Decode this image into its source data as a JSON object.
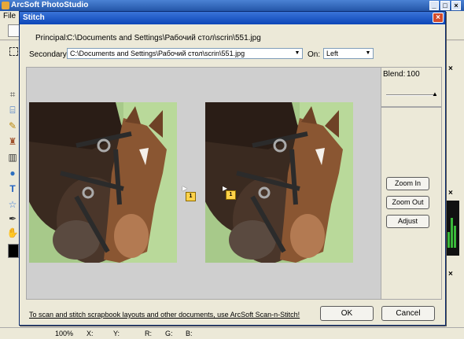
{
  "app": {
    "title": "ArcSoft PhotoStudio",
    "menu_file": "File",
    "help_glyph": "?",
    "minimize_glyph": "_",
    "restore_glyph": "□",
    "close_glyph": "×"
  },
  "status_bar": {
    "zoom": "100%",
    "x_label": "X:",
    "y_label": "Y:",
    "r_label": "R:",
    "g_label": "G:",
    "b_label": "B:"
  },
  "right_panel": {
    "close_glyph": "×"
  },
  "dialog": {
    "title": "Stitch",
    "close_glyph": "×",
    "principal_label": "Principal:",
    "principal_path": "C:\\Documents and Settings\\Рабочий стол\\scrin\\551.jpg",
    "secondary_label": "Secondary:",
    "secondary_path": "C:\\Documents and Settings\\Рабочий стол\\scrin\\551.jpg",
    "on_label": "On:",
    "on_value": "Left",
    "blend_label": "Blend:",
    "blend_value": "100",
    "zoom_in": "Zoom In",
    "zoom_out": "Zoom Out",
    "adjust": "Adjust",
    "scan_link": "To scan and stitch scrapbook layouts and other documents, use ArcSoft Scan-n-Stitch!",
    "ok": "OK",
    "cancel": "Cancel",
    "marker_left": "1",
    "marker_right": "1"
  },
  "colors": {
    "dialog_title": "#0c46b8",
    "marker": "#ffd24a"
  },
  "icons": [
    "selection-icon",
    "lasso-icon",
    "crop-icon",
    "pencil-icon",
    "stamp-icon",
    "gradient-icon",
    "drop-icon",
    "text-icon",
    "shape-icon",
    "eyedropper-icon",
    "hand-icon"
  ]
}
